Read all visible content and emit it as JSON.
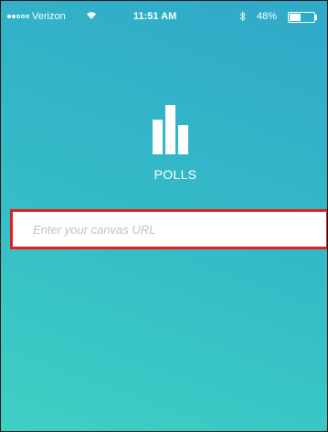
{
  "status_bar": {
    "carrier": "Verizon",
    "time": "11:51 AM",
    "battery_percent": "48%",
    "battery_level": 0.48,
    "signal_bars_filled": 2,
    "signal_bars_total": 5,
    "icons": [
      "wifi-icon",
      "bluetooth-icon",
      "battery-icon"
    ]
  },
  "app": {
    "name": "POLLS",
    "logo_icon": "bar-chart-icon"
  },
  "url_field": {
    "value": "",
    "placeholder": "Enter your canvas URL"
  },
  "colors": {
    "background_top": "#2fa9c9",
    "background_bottom": "#3fd0c4",
    "highlight_border": "#e41f1f",
    "text": "#ffffff"
  }
}
